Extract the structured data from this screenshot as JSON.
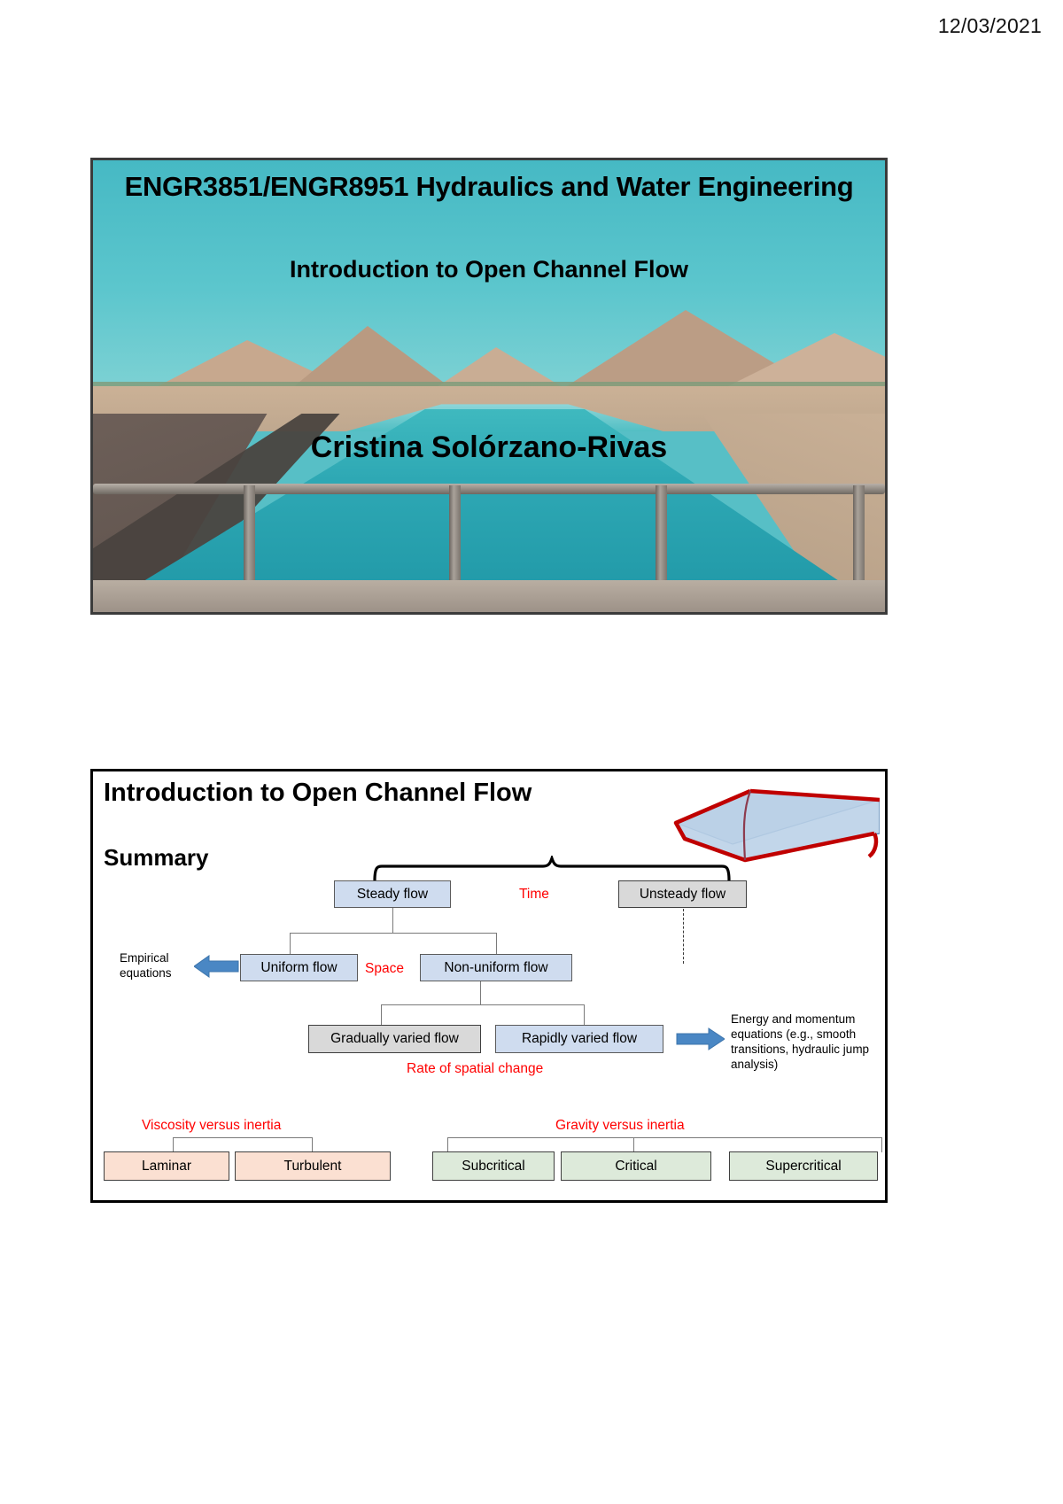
{
  "page": {
    "date": "12/03/2021"
  },
  "slide1": {
    "title": "ENGR3851/ENGR8951 Hydraulics and Water Engineering",
    "subtitle": "Introduction to Open Channel Flow",
    "author": "Cristina Solórzano-Rivas",
    "background_image": "open-channel-canal-photo"
  },
  "slide2": {
    "title": "Introduction to Open Channel Flow",
    "section_heading": "Summary",
    "icon": "trapezoidal-channel-sketch",
    "flowchart": {
      "boxes": [
        {
          "id": "steady",
          "label": "Steady flow",
          "fill": "#cfdcef"
        },
        {
          "id": "unsteady",
          "label": "Unsteady flow",
          "fill": "#d9d9d9"
        },
        {
          "id": "uniform",
          "label": "Uniform flow",
          "fill": "#cfdcef"
        },
        {
          "id": "nonuniform",
          "label": "Non-uniform flow",
          "fill": "#cfdcef"
        },
        {
          "id": "gvf",
          "label": "Gradually varied flow",
          "fill": "#d9d9d9"
        },
        {
          "id": "rvf",
          "label": "Rapidly varied flow",
          "fill": "#cfdcef"
        },
        {
          "id": "laminar",
          "label": "Laminar",
          "fill": "#fbe0d2"
        },
        {
          "id": "turbulent",
          "label": "Turbulent",
          "fill": "#fbe0d2"
        },
        {
          "id": "subcritical",
          "label": "Subcritical",
          "fill": "#ddeada"
        },
        {
          "id": "critical",
          "label": "Critical",
          "fill": "#ddeada"
        },
        {
          "id": "supercritical",
          "label": "Supercritical",
          "fill": "#ddeada"
        }
      ],
      "red_labels": [
        {
          "id": "time",
          "text": "Time"
        },
        {
          "id": "space",
          "text": "Space"
        },
        {
          "id": "rate",
          "text": "Rate of spatial change"
        },
        {
          "id": "viscosity",
          "text": "Viscosity versus inertia"
        },
        {
          "id": "gravity",
          "text": "Gravity versus inertia"
        }
      ],
      "annotations": [
        {
          "id": "empirical",
          "line1": "Empirical",
          "line2": "equations"
        },
        {
          "id": "energy",
          "text": "Energy and momentum equations (e.g., smooth transitions, hydraulic jump analysis)"
        }
      ],
      "accent_color": "#ff0000",
      "arrow_color": "#4a87c4"
    }
  }
}
